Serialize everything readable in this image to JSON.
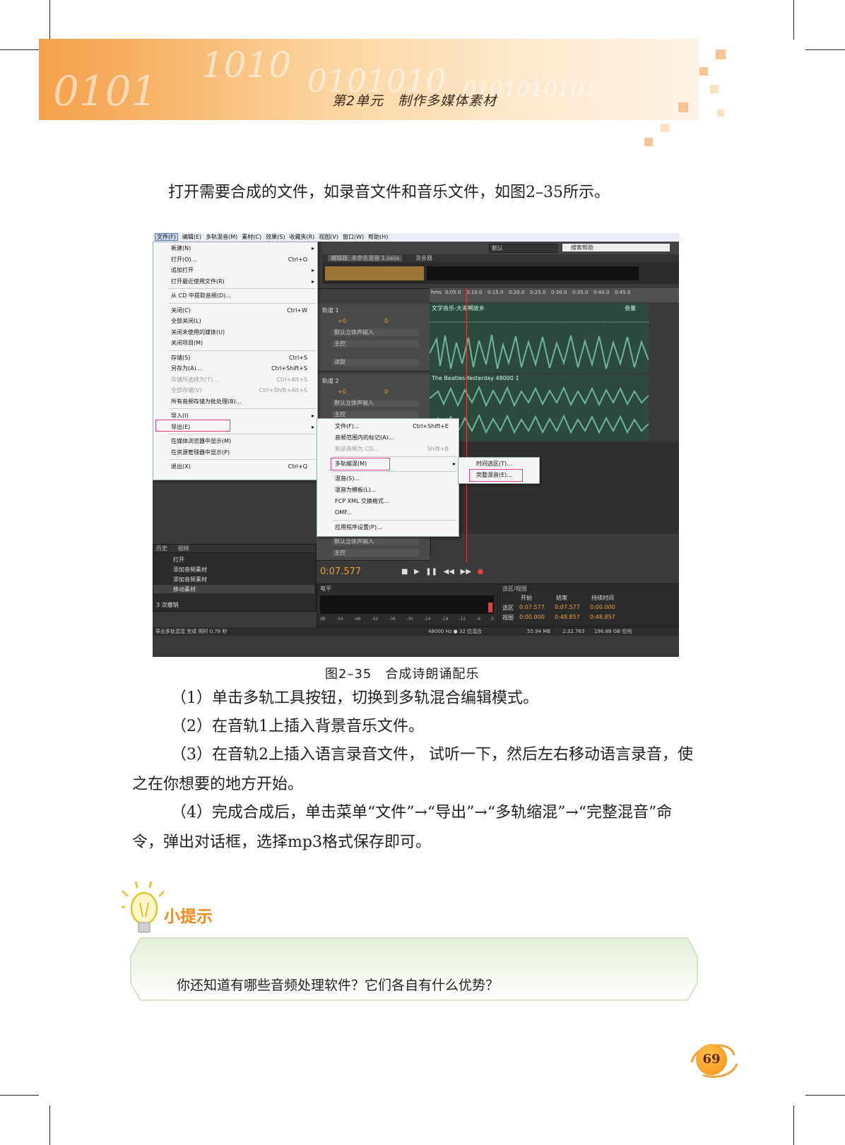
{
  "header": {
    "title": "第2单元　制作多媒体素材"
  },
  "intro": "打开需要合成的文件，如录音文件和音乐文件，如图2–35所示。",
  "app": {
    "menubar": [
      "文件(F)",
      "编辑(E)",
      "多轨混音(M)",
      "素材(C)",
      "效果(S)",
      "收藏夹(R)",
      "视图(V)",
      "窗口(W)",
      "帮助(H)"
    ],
    "file_menu": [
      {
        "label": "新建(N)",
        "shortcut": "",
        "arrow": "▸"
      },
      {
        "label": "打开(O)...",
        "shortcut": "Ctrl+O",
        "arrow": ""
      },
      {
        "label": "追加打开",
        "shortcut": "",
        "arrow": "▸"
      },
      {
        "label": "打开最近使用文件(R)",
        "shortcut": "",
        "arrow": "▸"
      },
      {
        "label": "从 CD 中提取音频(D)...",
        "shortcut": "",
        "arrow": ""
      },
      {
        "label": "关闭(C)",
        "shortcut": "Ctrl+W",
        "arrow": ""
      },
      {
        "label": "全部关闭(L)",
        "shortcut": "",
        "arrow": ""
      },
      {
        "label": "关闭未使用的媒体(U)",
        "shortcut": "",
        "arrow": ""
      },
      {
        "label": "关闭项目(M)",
        "shortcut": "",
        "arrow": ""
      },
      {
        "label": "存储(S)",
        "shortcut": "Ctrl+S",
        "arrow": ""
      },
      {
        "label": "另存为(A)...",
        "shortcut": "Ctrl+Shift+S",
        "arrow": ""
      },
      {
        "label": "存储所选择为(T)...",
        "shortcut": "Ctrl+Alt+S",
        "arrow": ""
      },
      {
        "label": "全部存储(V)",
        "shortcut": "Ctrl+Shift+Alt+S",
        "arrow": ""
      },
      {
        "label": "所有音频存储为批处理(B)...",
        "shortcut": "",
        "arrow": ""
      },
      {
        "label": "导入(I)",
        "shortcut": "",
        "arrow": "▸"
      },
      {
        "label": "导出(E)",
        "shortcut": "",
        "arrow": "▸"
      },
      {
        "label": "在媒体浏览器中显示(M)",
        "shortcut": "",
        "arrow": ""
      },
      {
        "label": "在资源管理器中显示(P)",
        "shortcut": "",
        "arrow": ""
      },
      {
        "label": "退出(X)",
        "shortcut": "Ctrl+Q",
        "arrow": ""
      }
    ],
    "export_menu": [
      {
        "label": "文件(F)...",
        "shortcut": "Ctrl+Shift+E",
        "arrow": ""
      },
      {
        "label": "音频范围内的标记(A)...",
        "shortcut": "",
        "arrow": ""
      },
      {
        "label": "刻录音频为 CD...",
        "shortcut": "Shift+B",
        "arrow": ""
      },
      {
        "label": "多轨缩混(M)",
        "shortcut": "",
        "arrow": "▸"
      },
      {
        "label": "混音(S)...",
        "shortcut": "",
        "arrow": ""
      },
      {
        "label": "混音为模板(L)...",
        "shortcut": "",
        "arrow": ""
      },
      {
        "label": "FCP XML 交换格式...",
        "shortcut": "",
        "arrow": ""
      },
      {
        "label": "OMF...",
        "shortcut": "",
        "arrow": ""
      },
      {
        "label": "应用程序设置(P)...",
        "shortcut": "",
        "arrow": ""
      }
    ],
    "mixdown_menu": [
      {
        "label": "时间选区(T)..."
      },
      {
        "label": "完整混音(E)..."
      }
    ],
    "workspace": "默认",
    "search_placeholder": "搜索帮助",
    "editor_tab": "编辑器: 未命名混音 1.sesx",
    "mixer_tab": "混音器",
    "ruler": [
      "hms",
      "0:05.0",
      "0:10.0",
      "0:15.0",
      "0:20.0",
      "0:25.0",
      "0:30.0",
      "0:35.0",
      "0:40.0",
      "0:45.0"
    ],
    "track1": {
      "name": "轨道 1",
      "input": "默认立体声输入",
      "output": "主控",
      "mode": "读取",
      "clip": "文学音乐-大海啊故乡",
      "vol": "+0",
      "pan": "0",
      "clip_right": "音量"
    },
    "track2": {
      "name": "轨道 2",
      "input": "默认立体声输入",
      "output": "主控",
      "clip": "The Beatles-Yesterday 48000 1",
      "vol": "+0",
      "pan": "0"
    },
    "track3": {
      "input": "默认立体声输入",
      "output": "主控"
    },
    "time": "0:07.577",
    "history_tab": "历史",
    "video_tab": "视频",
    "history_items": [
      "打开",
      "添加音频素材",
      "添加音频素材",
      "移动素材"
    ],
    "undo_count": "3 次撤销",
    "level_tab": "电平",
    "selection_tab": "选区/视图",
    "selection": {
      "headers": [
        "开始",
        "结束",
        "持续时间"
      ],
      "rows": [
        {
          "label": "选区",
          "values": [
            "0:07.577",
            "0:07.577",
            "0:00.000"
          ]
        },
        {
          "label": "视图",
          "values": [
            "0:00.000",
            "0:48.857",
            "0:48.857"
          ]
        }
      ]
    },
    "level_scale": [
      "dB",
      "-54",
      "-48",
      "-42",
      "-36",
      "-30",
      "-24",
      "-18",
      "-12",
      "-6",
      "0"
    ],
    "status": {
      "left": "导出多轨混混 完成 用时 0.78 秒",
      "format": "48000 Hz ● 32 位混合",
      "mem": "55.94 MB",
      "dur": "2:32.763",
      "disk": "196.88 GB 空闲"
    }
  },
  "caption": "图2–35　合成诗朗诵配乐",
  "steps": [
    "（1）单击多轨工具按钮，切换到多轨混合编辑模式。",
    "（2）在音轨1上插入背景音乐文件。",
    "（3）在音轨2上插入语言录音文件， 试听一下，然后左右移动语言录音，使之在你想要的地方开始。",
    "（4）完成合成后，单击菜单“文件”→“导出”→“多轨缩混”→“完整混音”命令，弹出对话框，选择mp3格式保存即可。"
  ],
  "tip": {
    "title": "小提示",
    "text": "你还知道有哪些音频处理软件？它们各自有什么优势？"
  },
  "page_number": "69",
  "colors": {
    "accent": "#f08a1c",
    "highlight": "#e0408a",
    "wave": "#6fb59a"
  }
}
